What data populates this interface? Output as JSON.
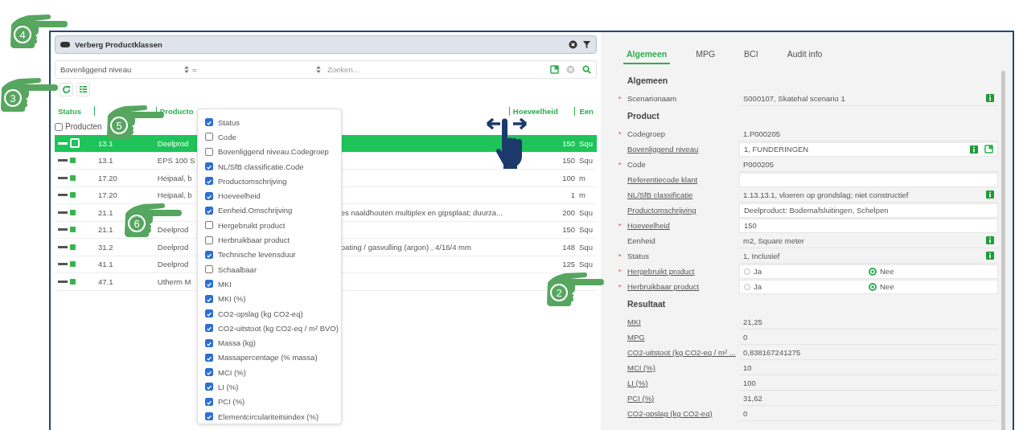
{
  "toggle_bar": {
    "label": "Verberg Productklassen",
    "on": true
  },
  "filter": {
    "field": "Bovenliggend niveau",
    "operator": "=",
    "placeholder": "Zoeken..."
  },
  "table": {
    "columns": [
      {
        "label": "Status"
      },
      {
        "label": "Producto"
      },
      {
        "label": "Hoeveelheid"
      },
      {
        "label": "Een"
      }
    ],
    "select_all": {
      "label": "Producten",
      "checked": false
    },
    "rows": [
      {
        "code": "13.1",
        "desc": "Deelprod",
        "qty": "150",
        "unit": "Squ",
        "selected": true
      },
      {
        "code": "13.1",
        "desc": "EPS 100 S",
        "qty": "150",
        "unit": "Squ",
        "selected": false
      },
      {
        "code": "17.20",
        "desc": "Heipaal, b",
        "qty": "100",
        "unit": "m",
        "selected": false
      },
      {
        "code": "17.20",
        "desc": "Heipaal, b",
        "qty": "1",
        "unit": "m",
        "selected": false
      },
      {
        "code": "21.1",
        "desc_tail": "es naaldhouten multiplex en gipsplaat; duurza...",
        "qty": "200",
        "unit": "Squ",
        "selected": false
      },
      {
        "code": "21.1",
        "desc": "Deelprod",
        "qty": "150",
        "unit": "Squ",
        "selected": false
      },
      {
        "code": "31.2",
        "desc": "Deelprod",
        "desc_tail": "oating / gasvulling (argon) , 4/16/4 mm",
        "qty": "148",
        "unit": "Squ",
        "selected": false
      },
      {
        "code": "41.1",
        "desc": "Deelprod",
        "qty": "125",
        "unit": "Squ",
        "selected": false
      },
      {
        "code": "47.1",
        "desc": "Utherm M",
        "selected": false
      }
    ]
  },
  "column_menu": [
    {
      "label": "Status",
      "checked": true
    },
    {
      "label": "Code",
      "checked": false
    },
    {
      "label": "Bovenliggend niveau.Codegroep",
      "checked": false
    },
    {
      "label": "NL/SfB classificatie.Code",
      "checked": true
    },
    {
      "label": "Productomschrijving",
      "checked": true
    },
    {
      "label": "Hoeveelheid",
      "checked": true
    },
    {
      "label": "Eenheid.Omschrijving",
      "checked": true
    },
    {
      "label": "Hergebruikt product",
      "checked": false
    },
    {
      "label": "Herbruikbaar product",
      "checked": false
    },
    {
      "label": "Technische levensduur",
      "checked": true
    },
    {
      "label": "Schaalbaar",
      "checked": false
    },
    {
      "label": "MKI",
      "checked": true
    },
    {
      "label": "MKI (%)",
      "checked": true
    },
    {
      "label": "CO2-opslag (kg CO2-eq)",
      "checked": true
    },
    {
      "label": "CO2-uitstoot (kg CO2-eq / m² BVO)",
      "checked": true
    },
    {
      "label": "Massa (kg)",
      "checked": true
    },
    {
      "label": "Massapercentage (% massa)",
      "checked": true
    },
    {
      "label": "MCI (%)",
      "checked": true
    },
    {
      "label": "LI (%)",
      "checked": true
    },
    {
      "label": "PCI (%)",
      "checked": true
    },
    {
      "label": "Elementcirculariteitsindex (%)",
      "checked": true
    }
  ],
  "detail": {
    "tabs": [
      {
        "label": "Algemeen",
        "selected": true
      },
      {
        "label": "MPG",
        "selected": false
      },
      {
        "label": "BCI",
        "selected": false
      },
      {
        "label": "Audit info",
        "selected": false
      }
    ],
    "sections": [
      {
        "title": "Algemeen",
        "fields": [
          {
            "kind": "text",
            "label": "Scenarionaam",
            "marker": "*",
            "link": false,
            "editable": false,
            "value": "S000107, Skatehal scenario 1",
            "info": true,
            "open": false
          }
        ]
      },
      {
        "title": "Product",
        "fields": [
          {
            "kind": "text",
            "label": "Codegroep",
            "marker": "*",
            "link": false,
            "editable": false,
            "value": "1.P000205",
            "info": false,
            "open": false
          },
          {
            "kind": "text",
            "label": "Bovenliggend niveau",
            "link": true,
            "editable": true,
            "value": "1, FUNDERINGEN",
            "info": true,
            "open": true
          },
          {
            "kind": "text",
            "label": "Code",
            "marker": "*",
            "link": false,
            "editable": false,
            "value": "P000205",
            "info": false,
            "open": false
          },
          {
            "kind": "text",
            "label": "Referentiecode klant",
            "link": true,
            "editable": true,
            "info": false,
            "open": false
          },
          {
            "kind": "text",
            "label": "NL/SfB classificatie",
            "link": true,
            "editable": false,
            "value": "1.13.13.1, vloeren op grondslag; niet constructief",
            "info": true,
            "open": false
          },
          {
            "kind": "text",
            "label": "Productomschrijving",
            "link": true,
            "editable": true,
            "value": "Deelproduct: Bodemafsluitingen, Schelpen",
            "info": false,
            "open": false
          },
          {
            "kind": "text",
            "label": "Hoeveelheid",
            "marker": "*",
            "link": true,
            "editable": true,
            "value": "150",
            "info": false,
            "open": false
          },
          {
            "kind": "text",
            "label": "Eenheid",
            "link": false,
            "editable": false,
            "value": "m2, Square meter",
            "info": true,
            "open": false
          },
          {
            "kind": "text",
            "label": "Status",
            "marker": "*",
            "link": false,
            "editable": false,
            "value": "1, Inclusief",
            "info": true,
            "open": false
          },
          {
            "kind": "radio",
            "label": "Hergebruikt product",
            "marker": "*",
            "link": true,
            "editable": true,
            "options": [
              {
                "label": "Ja",
                "selected": false
              },
              {
                "label": "Nee",
                "selected": true
              }
            ]
          },
          {
            "kind": "radio",
            "label": "Herbruikbaar product",
            "marker": "*",
            "link": true,
            "editable": true,
            "options": [
              {
                "label": "Ja",
                "selected": false
              },
              {
                "label": "Nee",
                "selected": true
              }
            ]
          }
        ]
      },
      {
        "title": "Resultaat",
        "fields": [
          {
            "kind": "text",
            "label": "MKI",
            "link": true,
            "editable": false,
            "value": "21,25",
            "info": false,
            "open": false
          },
          {
            "kind": "text",
            "label": "MPG",
            "link": true,
            "editable": false,
            "value": "0",
            "info": false,
            "open": false
          },
          {
            "kind": "text",
            "label": "CO2-uitstoot (kg CO2-eq / m² ...",
            "link": true,
            "editable": false,
            "value": "0,838167241275",
            "info": false,
            "open": false
          },
          {
            "kind": "text",
            "label": "MCI (%)",
            "link": true,
            "editable": false,
            "value": "10",
            "info": false,
            "open": false
          },
          {
            "kind": "text",
            "label": "LI (%)",
            "link": true,
            "editable": false,
            "value": "100",
            "info": false,
            "open": false
          },
          {
            "kind": "text",
            "label": "PCI (%)",
            "link": true,
            "editable": false,
            "value": "31,62",
            "info": false,
            "open": false
          },
          {
            "kind": "text",
            "label": "CO2-opslag (kg CO2-eq)",
            "link": true,
            "editable": false,
            "value": "0",
            "info": false,
            "open": false
          }
        ]
      }
    ]
  },
  "callouts": [
    {
      "number": "4"
    },
    {
      "number": "3"
    },
    {
      "number": "5"
    },
    {
      "number": "6"
    },
    {
      "number": "2"
    }
  ]
}
